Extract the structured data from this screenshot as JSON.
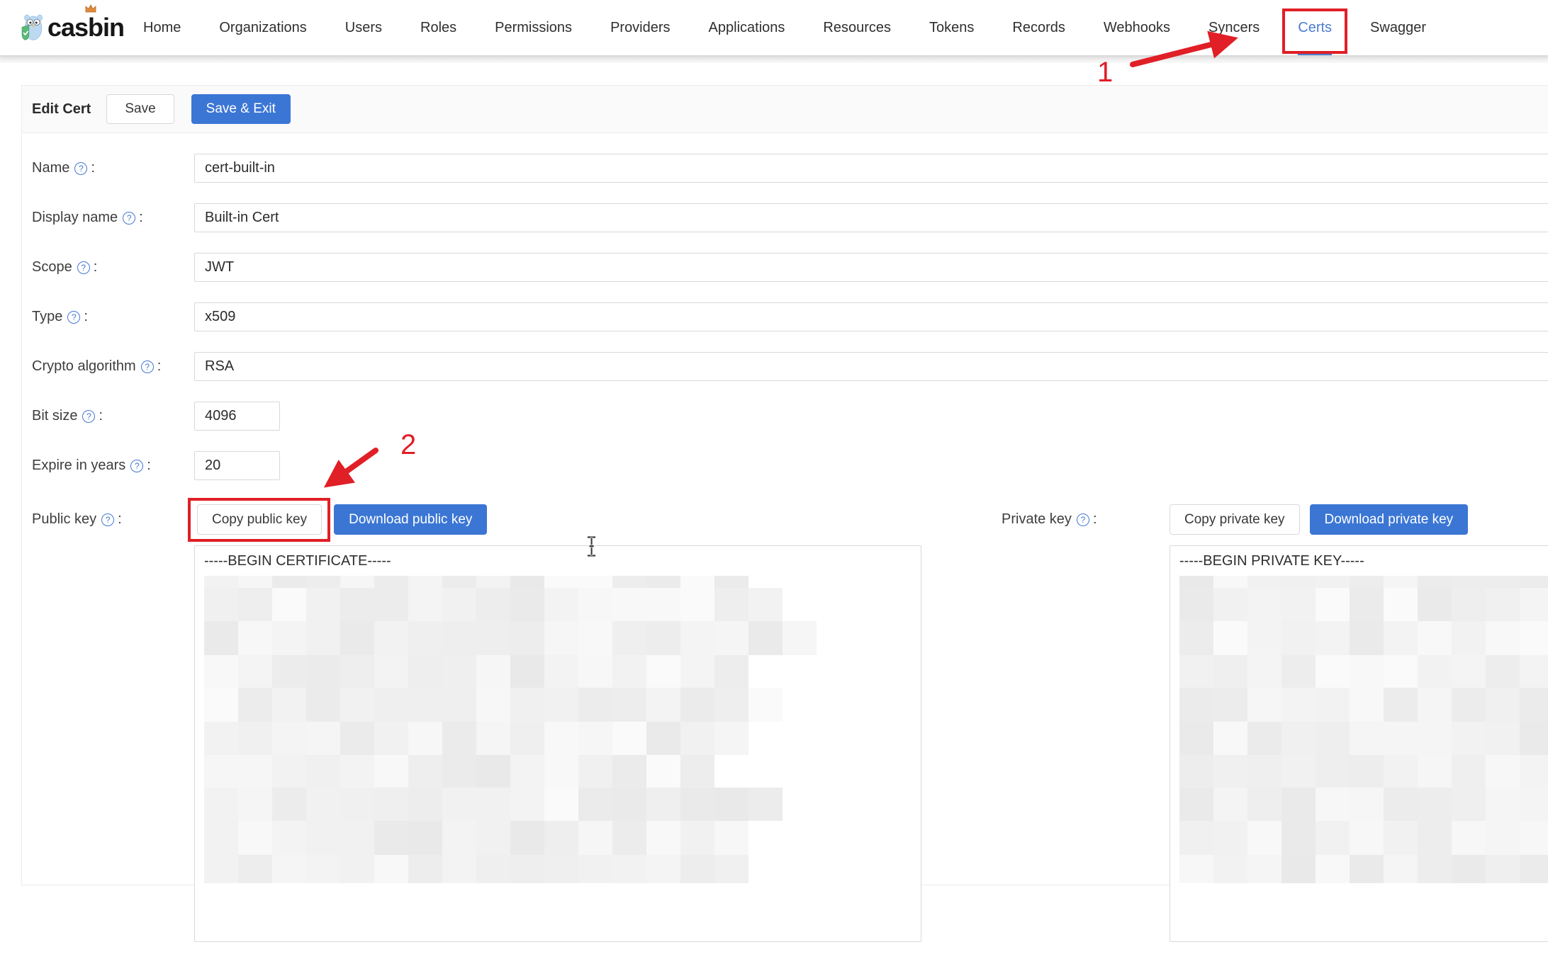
{
  "nav": {
    "logo_text": "casbin",
    "items": [
      {
        "label": "Home"
      },
      {
        "label": "Organizations"
      },
      {
        "label": "Users"
      },
      {
        "label": "Roles"
      },
      {
        "label": "Permissions"
      },
      {
        "label": "Providers"
      },
      {
        "label": "Applications"
      },
      {
        "label": "Resources"
      },
      {
        "label": "Tokens"
      },
      {
        "label": "Records"
      },
      {
        "label": "Webhooks"
      },
      {
        "label": "Syncers"
      },
      {
        "label": "Certs",
        "active": true,
        "annotated": true
      },
      {
        "label": "Swagger"
      }
    ]
  },
  "header": {
    "title": "Edit Cert",
    "save_label": "Save",
    "save_exit_label": "Save & Exit"
  },
  "form": {
    "colon": ":",
    "help_glyph": "?",
    "fields": [
      {
        "label": "Name",
        "value": "cert-built-in",
        "size": "full"
      },
      {
        "label": "Display name",
        "value": "Built-in Cert",
        "size": "full"
      },
      {
        "label": "Scope",
        "value": "JWT",
        "size": "full"
      },
      {
        "label": "Type",
        "value": "x509",
        "size": "full"
      },
      {
        "label": "Crypto algorithm",
        "value": "RSA",
        "size": "full"
      },
      {
        "label": "Bit size",
        "value": "4096",
        "size": "small"
      },
      {
        "label": "Expire in years",
        "value": "20",
        "size": "small"
      }
    ],
    "public_key": {
      "label": "Public key",
      "copy_label": "Copy public key",
      "download_label": "Download public key",
      "first_line": "-----BEGIN CERTIFICATE-----"
    },
    "private_key": {
      "label": "Private key",
      "copy_label": "Copy private key",
      "download_label": "Download private key",
      "first_line": "-----BEGIN PRIVATE KEY-----"
    }
  },
  "annotations": {
    "step1_label": "1",
    "step2_label": "2"
  },
  "colors": {
    "primary": "#3b76d4",
    "nav_active": "#4c7dd1",
    "annotation_red": "#e01f26"
  }
}
